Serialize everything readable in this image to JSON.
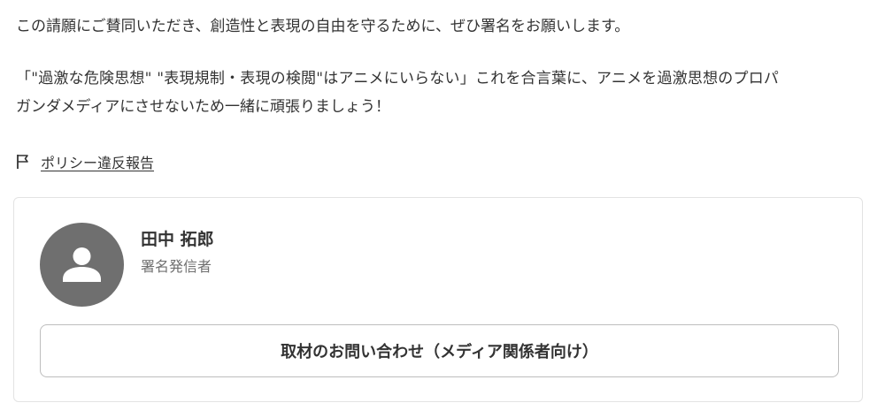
{
  "petition": {
    "paragraph_1": "この請願にご賛同いただき、創造性と表現の自由を守るために、ぜひ署名をお願いします。",
    "paragraph_2_line_1": "「\"過激な危険思想\" \"表現規制・表現の検閲\"はアニメにいらない」これを合言葉に、アニメを過激思想のプロパ",
    "paragraph_2_line_2": "ガンダメディアにさせないため一緒に頑張りましょう！"
  },
  "report": {
    "label": "ポリシー違反報告",
    "icon": "flag-icon"
  },
  "author": {
    "name": "田中 拓郎",
    "role": "署名発信者",
    "avatar_icon": "person-icon",
    "avatar_color": "#6f6f6f"
  },
  "press_contact": {
    "label": "取材のお問い合わせ（メディア関係者向け）"
  }
}
